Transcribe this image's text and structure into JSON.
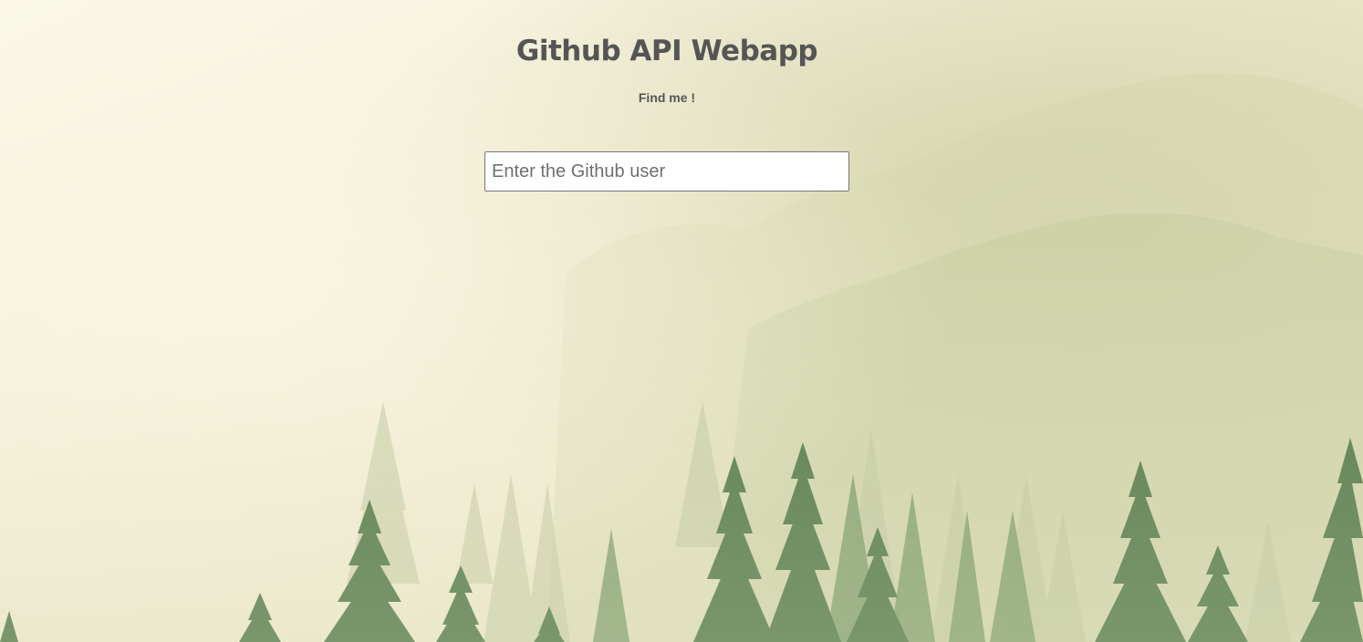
{
  "header": {
    "title": "Github API Webapp",
    "subtitle": "Find me !"
  },
  "search": {
    "value": "",
    "placeholder": "Enter the Github user"
  },
  "background": {
    "scene": "misty-pine-forest",
    "colors": {
      "fog": "#f6f1dc",
      "tree_dark": "#3f6b3a",
      "tree_mid": "#6e9160",
      "tree_light": "#a9ba8e"
    }
  }
}
